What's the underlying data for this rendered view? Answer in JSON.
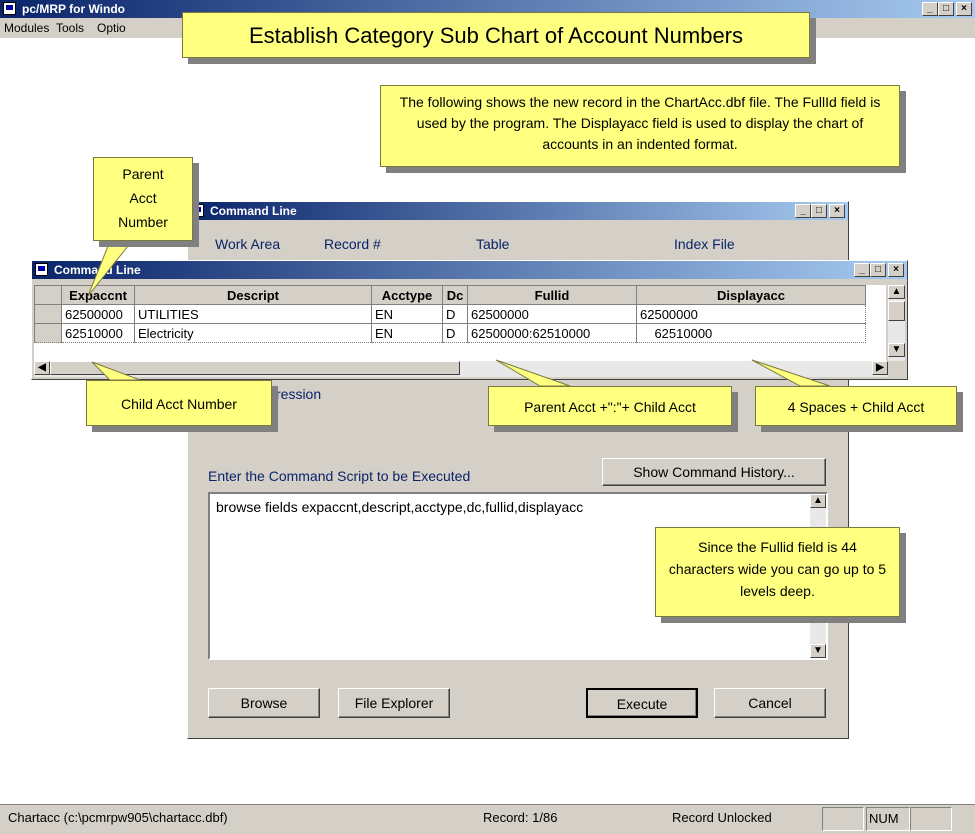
{
  "app": {
    "title": "pc/MRP for Windo",
    "menu": [
      "Modules",
      "Tools",
      "Optio"
    ]
  },
  "banner": {
    "title": "Establish Category Sub Chart of Account Numbers"
  },
  "callouts": {
    "info_top": "The following shows the new record in the ChartAcc.dbf file. The FullId field is used by the program.  The Displayacc field is used to display the chart of accounts in an indented format.",
    "parent_acct": "Parent Acct Number",
    "child_acct": "Child Acct Number",
    "parent_plus_child": "Parent Acct +\":\"+ Child Acct",
    "spaces_child": "4 Spaces +  Child Acct",
    "fullid_note": "Since the Fullid field is 44 characters wide you can go up to 5 levels deep."
  },
  "command_window": {
    "title": "Command Line",
    "headers": [
      "Work Area",
      "Record #",
      "Table",
      "Index File"
    ],
    "expression_label": "ression",
    "script_label": "Enter the Command Script to be Executed",
    "history_button": "Show Command History...",
    "script_text": "browse fields expaccnt,descript,acctype,dc,fullid,displayacc",
    "buttons": {
      "browse": "Browse",
      "file_explorer": "File Explorer",
      "execute": "Execute",
      "cancel": "Cancel"
    }
  },
  "browse_window": {
    "title": "Command Line",
    "columns": [
      "Expaccnt",
      "Descript",
      "Acctype",
      "Dc",
      "Fullid",
      "Displayacc"
    ],
    "rows": [
      [
        "62500000",
        "UTILITIES",
        "EN",
        "D",
        "62500000",
        "62500000"
      ],
      [
        "62510000",
        "Electricity",
        "EN",
        "D",
        "62500000:62510000",
        "    62510000"
      ]
    ]
  },
  "status_bar": {
    "file": "Chartacc (c:\\pcmrpw905\\chartacc.dbf)",
    "record": "Record: 1/86",
    "lock": "Record Unlocked",
    "num": "NUM"
  },
  "colors": {
    "callout": "#ffff80",
    "title_start": "#0a246a",
    "title_end": "#a6caf0",
    "label_blue": "#0a246a"
  }
}
